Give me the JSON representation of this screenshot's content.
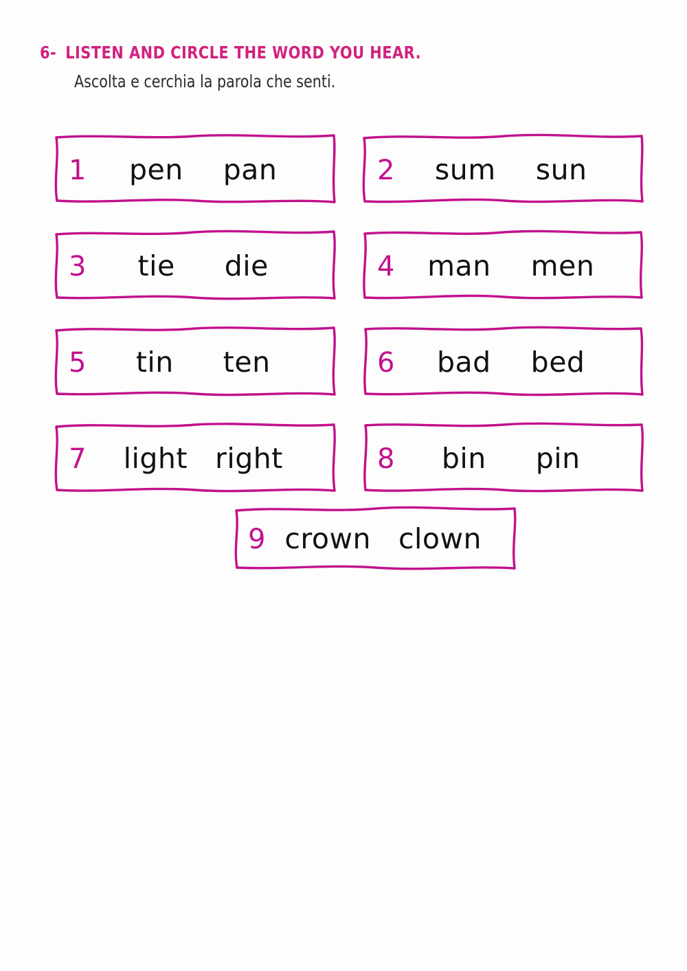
{
  "page": {
    "background_color": "#fdfdfd",
    "accent_color": "#c2118c",
    "heading_color": "#d2217f",
    "word_color": "#111111"
  },
  "heading": {
    "number": "6-",
    "title": "LISTEN AND CIRCLE THE WORD YOU HEAR.",
    "subtitle": "Ascolta e cerchia la parola che senti."
  },
  "exercises": [
    {
      "number": "1",
      "word_a": "pen",
      "word_b": "pan"
    },
    {
      "number": "2",
      "word_a": "sum",
      "word_b": "sun"
    },
    {
      "number": "3",
      "word_a": "tie",
      "word_b": "die"
    },
    {
      "number": "4",
      "word_a": "man",
      "word_b": "men"
    },
    {
      "number": "5",
      "word_a": "tin",
      "word_b": "ten"
    },
    {
      "number": "6",
      "word_a": "bad",
      "word_b": "bed"
    },
    {
      "number": "7",
      "word_a": "light",
      "word_b": "right"
    },
    {
      "number": "8",
      "word_a": "bin",
      "word_b": "pin"
    },
    {
      "number": "9",
      "word_a": "crown",
      "word_b": "clown"
    }
  ]
}
